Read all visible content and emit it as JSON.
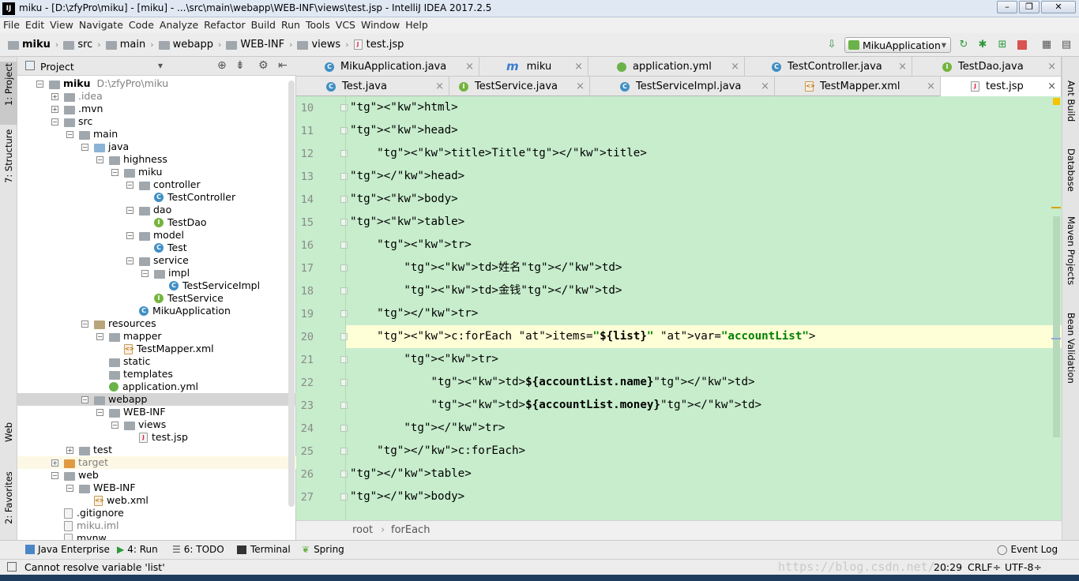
{
  "window": {
    "title": "miku - [D:\\zfyPro\\miku] - [miku] - ...\\src\\main\\webapp\\WEB-INF\\views\\test.jsp - IntelliJ IDEA 2017.2.5",
    "app_icon": "IJ"
  },
  "menu": [
    "File",
    "Edit",
    "View",
    "Navigate",
    "Code",
    "Analyze",
    "Refactor",
    "Build",
    "Run",
    "Tools",
    "VCS",
    "Window",
    "Help"
  ],
  "breadcrumb": [
    "miku",
    "src",
    "main",
    "webapp",
    "WEB-INF",
    "views",
    "test.jsp"
  ],
  "run_config": "MikuApplication",
  "left_tabs": [
    "1: Project",
    "7: Structure",
    "Web",
    "2: Favorites"
  ],
  "right_tabs": [
    "Ant Build",
    "Database",
    "Maven Projects",
    "Bean Validation"
  ],
  "project_panel": {
    "title": "Project",
    "tree": [
      {
        "label": "miku",
        "extra": "D:\\zfyPro\\miku",
        "type": "module",
        "bold": true
      },
      {
        "label": ".idea",
        "type": "folder",
        "muted": true
      },
      {
        "label": ".mvn",
        "type": "folder"
      },
      {
        "label": "src",
        "type": "folder"
      },
      {
        "label": "main",
        "type": "folder"
      },
      {
        "label": "java",
        "type": "src"
      },
      {
        "label": "highness",
        "type": "folder"
      },
      {
        "label": "miku",
        "type": "folder"
      },
      {
        "label": "controller",
        "type": "folder"
      },
      {
        "label": "TestController",
        "type": "class"
      },
      {
        "label": "dao",
        "type": "folder"
      },
      {
        "label": "TestDao",
        "type": "interface"
      },
      {
        "label": "model",
        "type": "folder"
      },
      {
        "label": "Test",
        "type": "class"
      },
      {
        "label": "service",
        "type": "folder"
      },
      {
        "label": "impl",
        "type": "folder"
      },
      {
        "label": "TestServiceImpl",
        "type": "class"
      },
      {
        "label": "TestService",
        "type": "interface"
      },
      {
        "label": "MikuApplication",
        "type": "app"
      },
      {
        "label": "resources",
        "type": "res"
      },
      {
        "label": "mapper",
        "type": "folder"
      },
      {
        "label": "TestMapper.xml",
        "type": "xml"
      },
      {
        "label": "static",
        "type": "folder"
      },
      {
        "label": "templates",
        "type": "folder"
      },
      {
        "label": "application.yml",
        "type": "yml"
      },
      {
        "label": "webapp",
        "type": "folder"
      },
      {
        "label": "WEB-INF",
        "type": "folder"
      },
      {
        "label": "views",
        "type": "folder"
      },
      {
        "label": "test.jsp",
        "type": "jsp"
      },
      {
        "label": "test",
        "type": "folder"
      },
      {
        "label": "target",
        "type": "target",
        "muted": true
      },
      {
        "label": "web",
        "type": "folder"
      },
      {
        "label": "WEB-INF",
        "type": "folder"
      },
      {
        "label": "web.xml",
        "type": "xml"
      },
      {
        "label": ".gitignore",
        "type": "file"
      },
      {
        "label": "miku.iml",
        "type": "file",
        "muted": true
      },
      {
        "label": "mvnw",
        "type": "file"
      }
    ]
  },
  "tabs_row1": [
    {
      "label": "MikuApplication.java",
      "icon": "app-icon"
    },
    {
      "label": "miku",
      "icon": "maven-icon"
    },
    {
      "label": "application.yml",
      "icon": "yml-icon"
    },
    {
      "label": "TestController.java",
      "icon": "class-icon"
    },
    {
      "label": "TestDao.java",
      "icon": "interface-icon"
    }
  ],
  "tabs_row2": [
    {
      "label": "Test.java",
      "icon": "class-icon"
    },
    {
      "label": "TestService.java",
      "icon": "interface-icon"
    },
    {
      "label": "TestServiceImpl.java",
      "icon": "class-icon"
    },
    {
      "label": "TestMapper.xml",
      "icon": "xml-icon"
    },
    {
      "label": "test.jsp",
      "icon": "jsp-icon",
      "active": true
    }
  ],
  "editor": {
    "line_numbers": [
      "10",
      "11",
      "12",
      "13",
      "14",
      "15",
      "16",
      "17",
      "18",
      "19",
      "20",
      "21",
      "22",
      "23",
      "24",
      "25",
      "26",
      "27"
    ],
    "current_line": "20",
    "code_lines": [
      "<html>",
      "<head>",
      "    <title>Title</title>",
      "</head>",
      "<body>",
      "<table>",
      "    <tr>",
      "        <td>姓名</td>",
      "        <td>金钱</td>",
      "    </tr>",
      "    <c:forEach items=\"${list}\" var=\"accountList\">",
      "        <tr>",
      "            <td>${accountList.name}</td>",
      "            <td>${accountList.money}</td>",
      "        </tr>",
      "    </c:forEach>",
      "</table>",
      "</body>"
    ],
    "breadcrumb": [
      "root",
      "forEach"
    ]
  },
  "tool_windows": [
    "Java Enterprise",
    "4: Run",
    "6: TODO",
    "Terminal",
    "Spring",
    "Event Log"
  ],
  "status": {
    "message": "Cannot resolve variable 'list'",
    "position": "20:29",
    "line_sep": "CRLF÷",
    "encoding": "UTF-8÷",
    "watermark": "https://blog.csdn.net/..."
  },
  "colors": {
    "editor_bg": "#c7edcc",
    "current_line": "#ffffd7",
    "tag": "#000080",
    "attr": "#0000ff",
    "string": "#008000"
  }
}
